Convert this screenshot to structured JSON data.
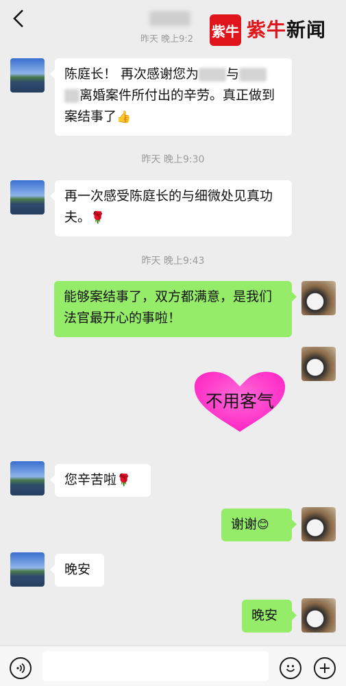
{
  "header": {
    "back_icon": "chevron-left-icon",
    "last_seen": "昨天 晚上9:2",
    "watermark_logo": "紫牛",
    "watermark_brand": "紫牛",
    "watermark_suffix": "新闻"
  },
  "messages": [
    {
      "side": "in",
      "text_parts": [
        "陈庭长！ 再次感谢您为",
        "与",
        "离婚案件所付出的辛劳。真正做到案结事了"
      ],
      "emoji": "thumbs-up"
    },
    {
      "timestamp": "昨天 晚上9:30"
    },
    {
      "side": "in",
      "text": "再一次感受陈庭长的与细微处见真功夫。",
      "emoji": "rose"
    },
    {
      "timestamp": "昨天 晚上9:43"
    },
    {
      "side": "out",
      "text": "能够案结事了，双方都满意，是我们法官最开心的事啦！"
    },
    {
      "side": "out",
      "sticker": "heart",
      "sticker_text": "不用客气"
    },
    {
      "side": "in",
      "text": "您辛苦啦",
      "emoji": "rose"
    },
    {
      "side": "out",
      "text": "谢谢",
      "emoji": "smile"
    },
    {
      "side": "in",
      "text": "晚安"
    },
    {
      "side": "out",
      "text": "晚安"
    }
  ],
  "colors": {
    "outgoing_bubble": "#95ec69",
    "incoming_bubble": "#ffffff",
    "background": "#ededed",
    "sticker": "#ff33cc"
  },
  "bottom_bar": {
    "voice_icon": "voice-icon",
    "emoji_icon": "emoji-icon",
    "plus_icon": "plus-icon"
  }
}
